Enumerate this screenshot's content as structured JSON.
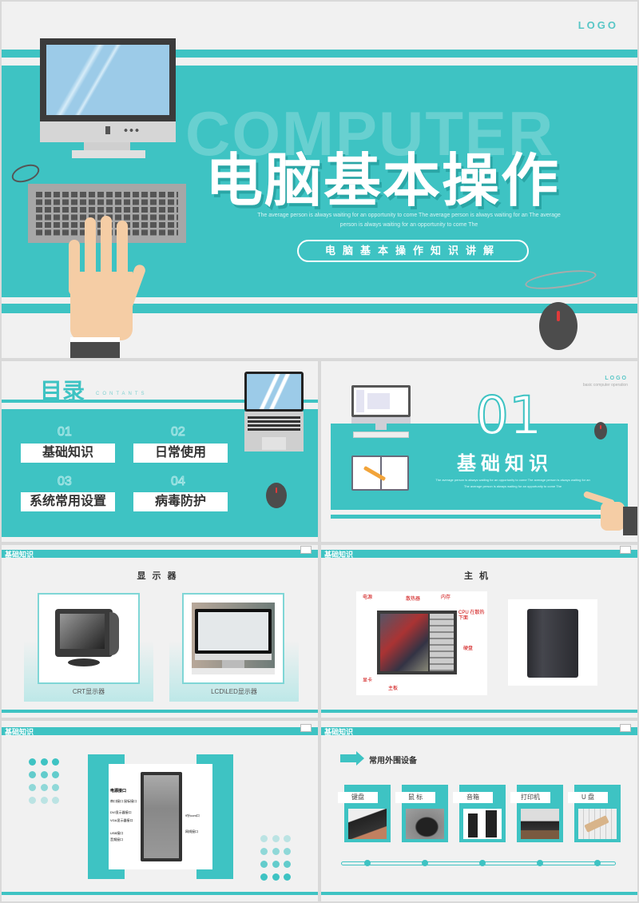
{
  "colors": {
    "accent": "#3ec3c3",
    "background": "#f1f1f1",
    "text_dark": "#333333"
  },
  "cover": {
    "logo": "LOGO",
    "background_word": "COMPUTER",
    "title": "电脑基本操作",
    "subtitle": "The average person is always waiting for an opportunity to come The average person is always waiting for an The average person is always waiting for an opportunity to come The",
    "pill_label": "电脑基本操作知识讲解"
  },
  "contents": {
    "heading": "目录",
    "heading_en": "CONTANTS",
    "items": [
      {
        "num": "01",
        "label": "基础知识"
      },
      {
        "num": "02",
        "label": "日常使用"
      },
      {
        "num": "03",
        "label": "系统常用设置"
      },
      {
        "num": "04",
        "label": "病毒防护"
      }
    ]
  },
  "section1": {
    "logo": "LOGO",
    "logo_sub": "basic computer operation",
    "number": "01",
    "title": "基础知识",
    "subtitle": "The average person is always waiting for an opportunity to come The average person is always waiting for an The average person is always waiting for an opportunity to come The"
  },
  "monitors": {
    "section_label": "基础知识",
    "title": "显示器",
    "cards": [
      {
        "caption": "CRT显示器"
      },
      {
        "caption": "LCD\\LED显示器"
      }
    ]
  },
  "host": {
    "section_label": "基础知识",
    "title": "主机",
    "diagram_labels": [
      "电源",
      "散热器",
      "内存",
      "CPU 在散热下面",
      "硬盘",
      "显卡",
      "主板"
    ]
  },
  "ports": {
    "section_label": "基础知识",
    "labels_left": [
      "电源接口",
      "串口接口 鼠标接口",
      "DVI显示器接口",
      "VGA显示器接口",
      "USB接口",
      "音频接口"
    ],
    "labels_right": [
      "9针com口",
      "网线接口"
    ]
  },
  "peripherals": {
    "section_label": "基础知识",
    "title": "常用外围设备",
    "items": [
      {
        "label": "键盘"
      },
      {
        "label": "鼠 标"
      },
      {
        "label": "音箱"
      },
      {
        "label": "打印机"
      },
      {
        "label": "U 盘"
      }
    ]
  }
}
